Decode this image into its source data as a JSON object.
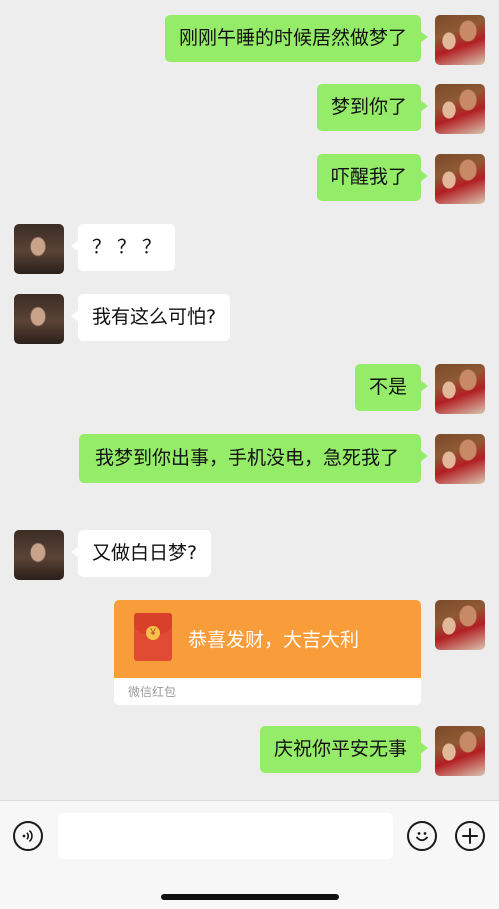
{
  "messages": [
    {
      "from": "me",
      "text": "刚刚午睡的时候居然做梦了"
    },
    {
      "from": "me",
      "text": "梦到你了"
    },
    {
      "from": "me",
      "text": "吓醒我了"
    },
    {
      "from": "other",
      "text": "？？？"
    },
    {
      "from": "other",
      "text": "我有这么可怕?"
    },
    {
      "from": "me",
      "text": "不是"
    },
    {
      "from": "me",
      "text": "我梦到你出事，手机没电，急死我了"
    },
    {
      "from": "other",
      "text": "又做白日梦?"
    },
    {
      "from": "me",
      "type": "red-packet",
      "text": "恭喜发财，大吉大利",
      "label": "微信红包",
      "coin": "￥"
    },
    {
      "from": "me",
      "text": "庆祝你平安无事"
    }
  ],
  "input": {
    "placeholder": "",
    "value": ""
  },
  "icons": {
    "voice": "voice-icon",
    "emoji": "emoji-icon",
    "add": "add-icon"
  },
  "colors": {
    "background": "#ededed",
    "my_bubble": "#95ec69",
    "their_bubble": "#ffffff",
    "red_packet": "#f89d3a"
  }
}
